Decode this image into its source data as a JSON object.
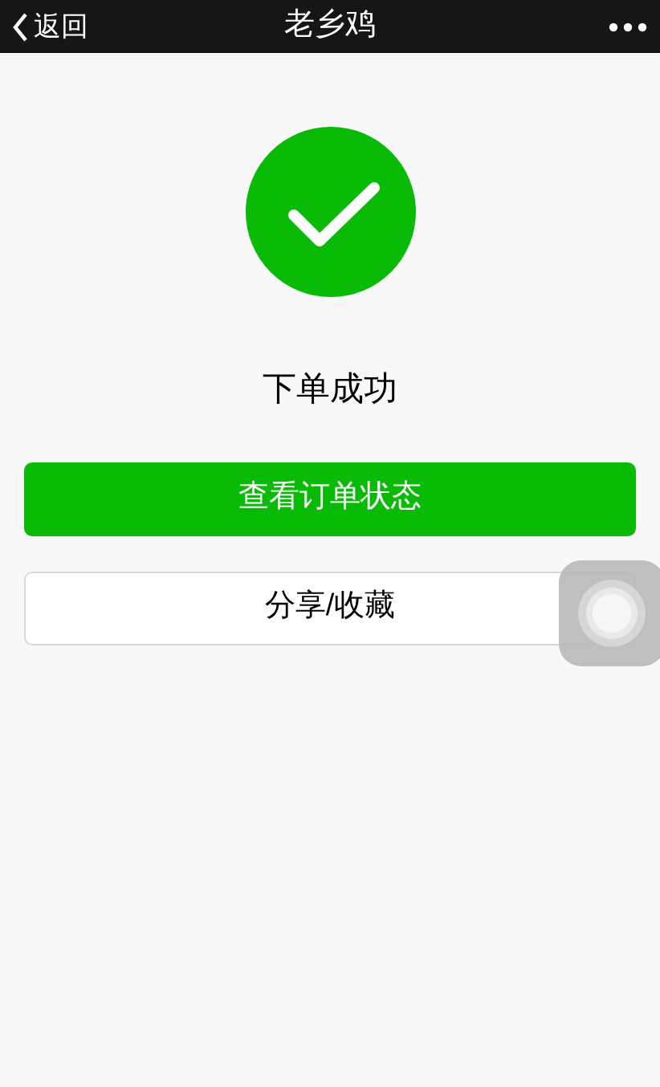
{
  "nav_bar": {
    "back_label": "返回",
    "title": "老乡鸡"
  },
  "result": {
    "message": "下单成功"
  },
  "buttons": [
    {
      "label": "查看订单状态",
      "kind": "primary"
    },
    {
      "label": "分享/收藏",
      "kind": "secondary"
    }
  ]
}
